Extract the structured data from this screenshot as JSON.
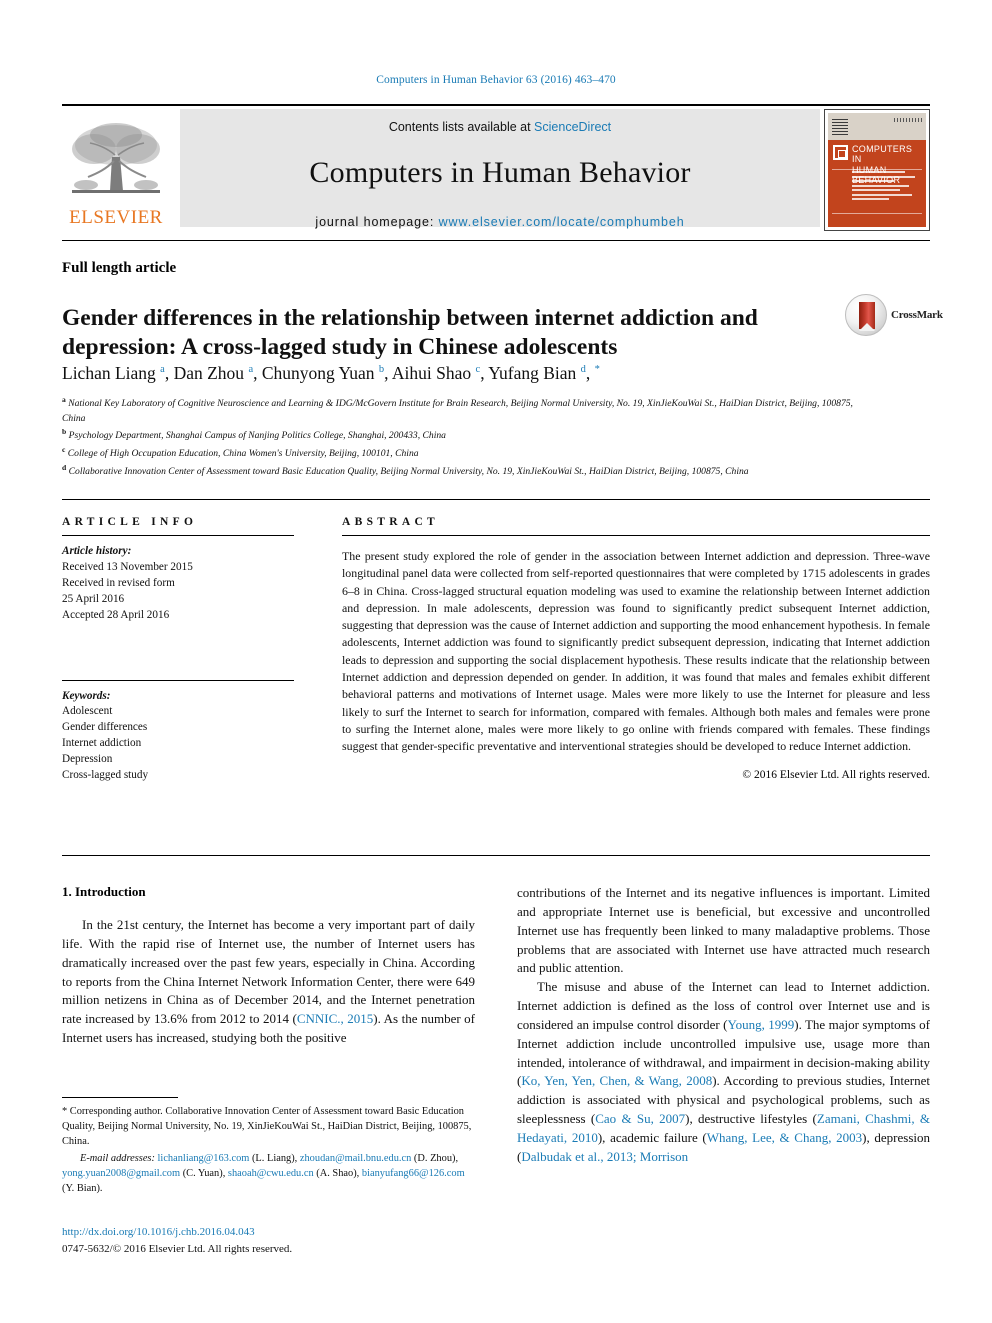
{
  "running_head": "Computers in Human Behavior 63 (2016) 463–470",
  "masthead": {
    "publisher_logo_label": "ELSEVIER",
    "contents_prefix": "Contents lists available at ",
    "contents_link": "ScienceDirect",
    "journal_name": "Computers in Human Behavior",
    "homepage_prefix": "journal homepage: ",
    "homepage_url": "www.elsevier.com/locate/comphumbeh",
    "cover": {
      "title_line1": "COMPUTERS IN",
      "title_line2": "HUMAN BEHAVIOR"
    }
  },
  "article": {
    "type": "Full length article",
    "title": "Gender differences in the relationship between internet addiction and depression: A cross-lagged study in Chinese adolescents",
    "crossmark_label": "CrossMark",
    "authors_html": "Lichan Liang <sup>a</sup>, Dan Zhou <sup>a</sup>, Chunyong Yuan <sup>b</sup>, Aihui Shao <sup>c</sup>, Yufang Bian <sup>d</sup>, <sup>*</sup>",
    "affiliations": [
      {
        "marker": "a",
        "text": "National Key Laboratory of Cognitive Neuroscience and Learning & IDG/McGovern Institute for Brain Research, Beijing Normal University, No. 19, XinJieKouWai St., HaiDian District, Beijing, 100875, China"
      },
      {
        "marker": "b",
        "text": "Psychology Department, Shanghai Campus of Nanjing Politics College, Shanghai, 200433, China"
      },
      {
        "marker": "c",
        "text": "College of High Occupation Education, China Women's University, Beijing, 100101, China"
      },
      {
        "marker": "d",
        "text": "Collaborative Innovation Center of Assessment toward Basic Education Quality, Beijing Normal University, No. 19, XinJieKouWai St., HaiDian District, Beijing, 100875, China"
      }
    ]
  },
  "article_info": {
    "heading": "ARTICLE INFO",
    "history_label": "Article history:",
    "history_lines": [
      "Received 13 November 2015",
      "Received in revised form",
      "25 April 2016",
      "Accepted 28 April 2016"
    ],
    "keywords_label": "Keywords:",
    "keywords": [
      "Adolescent",
      "Gender differences",
      "Internet addiction",
      "Depression",
      "Cross-lagged study"
    ]
  },
  "abstract": {
    "heading": "ABSTRACT",
    "text": "The present study explored the role of gender in the association between Internet addiction and depression. Three-wave longitudinal panel data were collected from self-reported questionnaires that were completed by 1715 adolescents in grades 6–8 in China. Cross-lagged structural equation modeling was used to examine the relationship between Internet addiction and depression. In male adolescents, depression was found to significantly predict subsequent Internet addiction, suggesting that depression was the cause of Internet addiction and supporting the mood enhancement hypothesis. In female adolescents, Internet addiction was found to significantly predict subsequent depression, indicating that Internet addiction leads to depression and supporting the social displacement hypothesis. These results indicate that the relationship between Internet addiction and depression depended on gender. In addition, it was found that males and females exhibit different behavioral patterns and motivations of Internet usage. Males were more likely to use the Internet for pleasure and less likely to surf the Internet to search for information, compared with females. Although both males and females were prone to surfing the Internet alone, males were more likely to go online with friends compared with females. These findings suggest that gender-specific preventative and interventional strategies should be developed to reduce Internet addiction.",
    "copyright": "© 2016 Elsevier Ltd. All rights reserved."
  },
  "body": {
    "section_number_title": "1. Introduction",
    "left_paragraph_1_pre": "In the 21st century, the Internet has become a very important part of daily life. With the rapid rise of Internet use, the number of Internet users has dramatically increased over the past few years, especially in China. According to reports from the China Internet Network Information Center, there were 649 million netizens in China as of December 2014, and the Internet penetration rate increased by 13.6% from 2012 to 2014 (",
    "left_ref_1": "CNNIC., 2015",
    "left_paragraph_1_post": "). As the number of Internet users has increased, studying both the positive",
    "right_paragraph_1": "contributions of the Internet and its negative influences is important. Limited and appropriate Internet use is beneficial, but excessive and uncontrolled Internet use has frequently been linked to many maladaptive problems. Those problems that are associated with Internet use have attracted much research and public attention.",
    "right_p2_a": "The misuse and abuse of the Internet can lead to Internet addiction. Internet addiction is defined as the loss of control over Internet use and is considered an impulse control disorder (",
    "right_ref_young": "Young, 1999",
    "right_p2_b": "). The major symptoms of Internet addiction include uncontrolled impulsive use, usage more than intended, intolerance of withdrawal, and impairment in decision-making ability (",
    "right_ref_ko": "Ko, Yen, Yen, Chen, & Wang, 2008",
    "right_p2_c": "). According to previous studies, Internet addiction is associated with physical and psychological problems, such as sleeplessness (",
    "right_ref_cao": "Cao & Su, 2007",
    "right_p2_d": "), destructive lifestyles (",
    "right_ref_zamani": "Zamani, Chashmi, & Hedayati, 2010",
    "right_p2_e": "), academic failure (",
    "right_ref_whang": "Whang, Lee, & Chang, 2003",
    "right_p2_f": "), depression (",
    "right_ref_dalbudak": "Dalbudak et al., 2013; Morrison"
  },
  "footnote": {
    "corresponding": "* Corresponding author. Collaborative Innovation Center of Assessment toward Basic Education Quality, Beijing Normal University, No. 19, XinJieKouWai St., HaiDian District, Beijing, 100875, China.",
    "email_label": "E-mail addresses:",
    "emails": [
      {
        "address": "lichanliang@163.com",
        "owner": "(L. Liang)"
      },
      {
        "address": "zhoudan@mail.bnu.edu.cn",
        "owner": "(D. Zhou)"
      },
      {
        "address": "yong.yuan2008@gmail.com",
        "owner": "(C. Yuan)"
      },
      {
        "address": "shaoah@cwu.edu.cn",
        "owner": "(A. Shao)"
      },
      {
        "address": "bianyufang66@126.com",
        "owner": "(Y. Bian)"
      }
    ],
    "doi": "http://dx.doi.org/10.1016/j.chb.2016.04.043",
    "issn_line": "0747-5632/© 2016 Elsevier Ltd. All rights reserved."
  },
  "colors": {
    "link_blue": "#1a7bb5",
    "elsevier_orange": "#e87722",
    "cover_orange": "#c2441d"
  }
}
